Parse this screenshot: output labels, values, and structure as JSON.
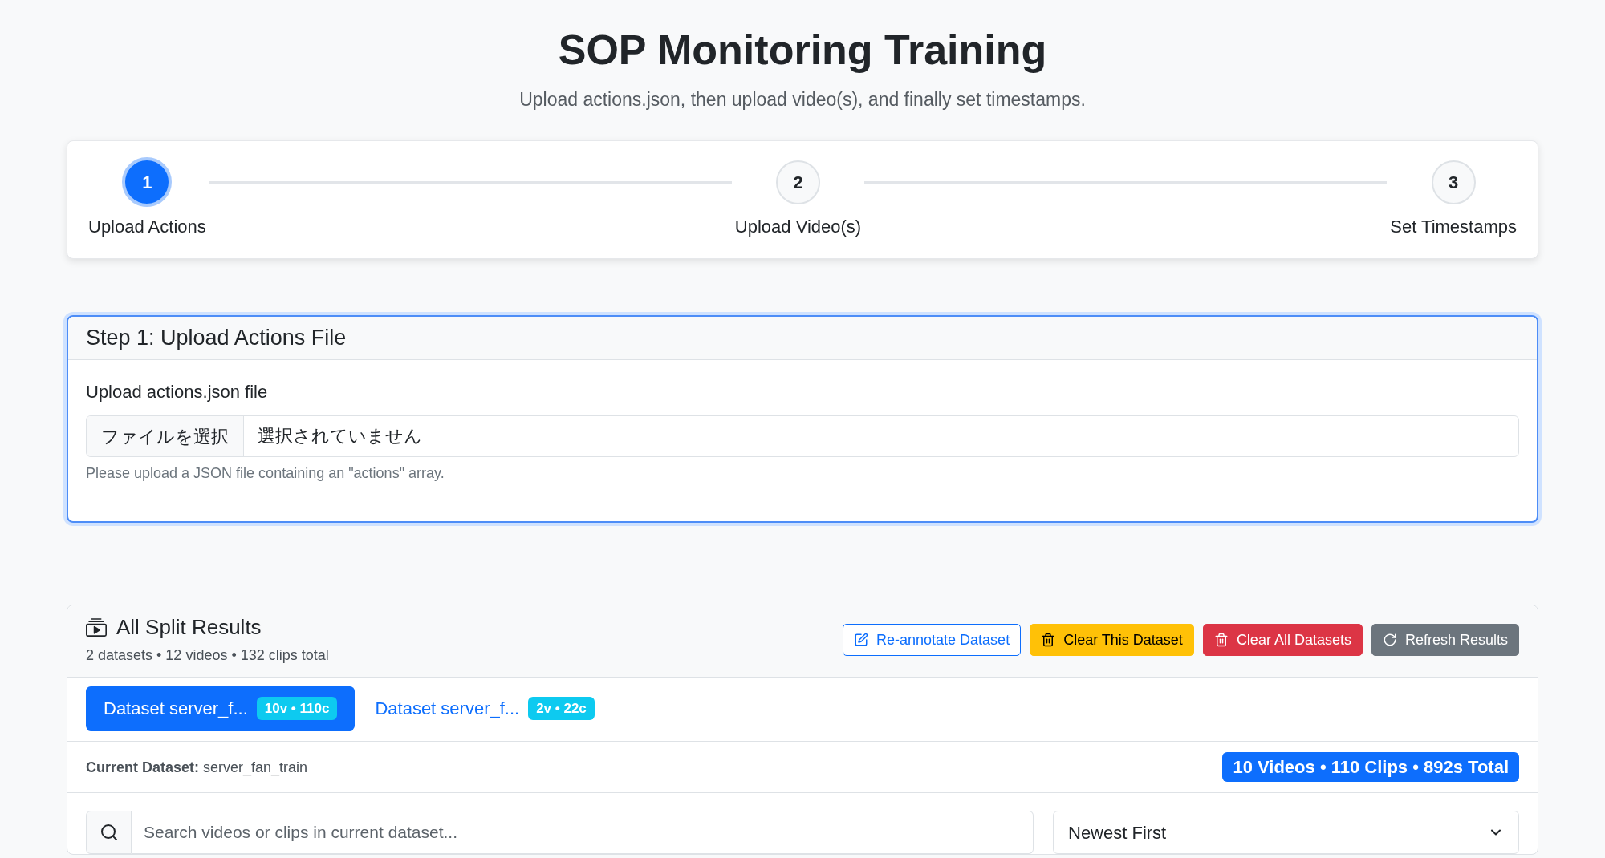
{
  "header": {
    "title": "SOP Monitoring Training",
    "subtitle": "Upload actions.json, then upload video(s), and finally set timestamps."
  },
  "steps": [
    {
      "number": "1",
      "label": "Upload Actions",
      "selected": true
    },
    {
      "number": "2",
      "label": "Upload Video(s)",
      "selected": false
    },
    {
      "number": "3",
      "label": "Set Timestamps",
      "selected": false
    }
  ],
  "step_card": {
    "title": "Step 1: Upload Actions File",
    "focused": true,
    "field_label": "Upload actions.json file",
    "file_button": "ファイルを選択",
    "file_status": "選択されていません",
    "help": "Please upload a JSON file containing an \"actions\" array."
  },
  "results": {
    "title": "All Split Results",
    "summary": "2 datasets • 12 videos • 132 clips total",
    "buttons": [
      {
        "label": "Re-annotate Dataset",
        "kind": "outline"
      },
      {
        "label": "Clear This Dataset",
        "kind": "warning"
      },
      {
        "label": "Clear All Datasets",
        "kind": "danger"
      },
      {
        "label": "Refresh Results",
        "kind": "secondary"
      }
    ],
    "dataset_tabs": [
      {
        "label": "Dataset server_f...",
        "badge": "10v • 110c",
        "selected": true
      },
      {
        "label": "Dataset server_f...",
        "badge": "2v • 22c",
        "selected": false
      }
    ],
    "current_dataset": "**Current Dataset:** server_fan_train",
    "totals": "10 Videos • 110 Clips • 892s Total",
    "search": {
      "placeholder": "Search videos or clips in current dataset..."
    },
    "sort": {
      "value": "Newest First"
    }
  }
}
